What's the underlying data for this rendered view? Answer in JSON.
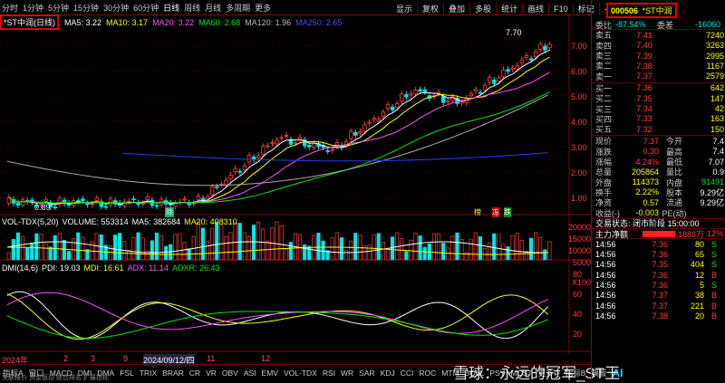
{
  "top_periods": [
    "分时",
    "1分钟",
    "5分钟",
    "15分钟",
    "30分钟",
    "60分钟",
    "日线",
    "周线",
    "月线",
    "多周期",
    "更多"
  ],
  "active_period": "日线",
  "toolbar": [
    "显示",
    "复权",
    "叠加",
    "多股",
    "统计",
    "画线",
    "F10",
    "标记",
    "-自选",
    "返回"
  ],
  "stock_name_badge": "*ST中润(日线)",
  "ma_legend": {
    "ma5": "MA5: 3.22",
    "ma10": "MA10: 3.17",
    "ma20": "MA20: 3.22",
    "ma60": "MA60: 2.68",
    "ma120": "MA120: 1.96",
    "ma250": "MA250: 2.65"
  },
  "price_axis": [
    "7.00",
    "6.00",
    "5.00",
    "4.00",
    "3.00",
    "2.00",
    "1.00"
  ],
  "high_marker": "7.70",
  "low_marker": "0.89",
  "event_labels": {
    "left": "除",
    "right1": "榜",
    "right2": "冻",
    "right3": "跌"
  },
  "vol_legend": {
    "name": "VOL-TDX(5,20)",
    "volume": "VOLUME: 553314",
    "ma5": "MA5: 382684",
    "ma20": "MA20: 408310"
  },
  "vol_axis": [
    "20000",
    "15000",
    "10000",
    "5000",
    "X100"
  ],
  "dmi_legend": {
    "name": "DMI(14,6)",
    "pdi": "PDI: 19.03",
    "mdi": "MDI: 16.61",
    "adx": "ADX: 11.14",
    "adxr": "ADXR: 26.43"
  },
  "dmi_axis": [
    "80",
    "60",
    "40",
    "20"
  ],
  "date_labels": [
    "2024年",
    "2",
    "3",
    "9",
    "2024/09/12/四",
    "11",
    "12"
  ],
  "bottom_tabs": [
    "指标A",
    "窗口",
    "MACD",
    "DMI",
    "DMA",
    "FSL",
    "TRIX",
    "BRAR",
    "CR",
    "VR",
    "OBV",
    "ASI",
    "EMV",
    "VOL-TDX",
    "RSI",
    "WR",
    "SAR",
    "KDJ",
    "CCI",
    "ROC",
    "MTM",
    "BOLL",
    "PSY",
    "MCST",
    "更多 >",
    "指标B",
    "模板",
    "AI"
  ],
  "bottom_sub": "关联报价  资金驱动  综合排名  扩展指标",
  "watermark": "雪球：永远的冠军_ST王",
  "quote": {
    "code": "000506",
    "name": "*ST中润",
    "webi_label": "委比",
    "webi": "-87.54%",
    "weicha_label": "委差",
    "weicha": "-16060",
    "sells": [
      {
        "label": "卖五",
        "price": "7.41",
        "vol": "7240"
      },
      {
        "label": "卖四",
        "price": "7.40",
        "vol": "3263"
      },
      {
        "label": "卖三",
        "price": "7.39",
        "vol": "2995"
      },
      {
        "label": "卖二",
        "price": "7.38",
        "vol": "1167"
      },
      {
        "label": "卖一",
        "price": "7.37",
        "vol": "2579"
      }
    ],
    "buys": [
      {
        "label": "买一",
        "price": "7.36",
        "vol": "642"
      },
      {
        "label": "买二",
        "price": "7.35",
        "vol": "147"
      },
      {
        "label": "买三",
        "price": "7.34",
        "vol": "42"
      },
      {
        "label": "买四",
        "price": "7.33",
        "vol": "163"
      },
      {
        "label": "买五",
        "price": "7.32",
        "vol": "150"
      }
    ],
    "stats": [
      {
        "l1": "现价",
        "v1": "7.37",
        "l2": "今开",
        "v2": "7.4"
      },
      {
        "l1": "涨跌",
        "v1": "0.30",
        "l2": "最高",
        "v2": "7.4"
      },
      {
        "l1": "涨幅",
        "v1": "4.24%",
        "l2": "最低",
        "v2": "7.07"
      },
      {
        "l1": "总量",
        "v1": "205864",
        "l2": "量比",
        "v2": "0.9"
      },
      {
        "l1": "外盘",
        "v1": "114373",
        "l2": "内盘",
        "v2": "91491"
      },
      {
        "l1": "换手",
        "v1": "2.22%",
        "l2": "股本",
        "v2": "9.29亿"
      },
      {
        "l1": "净资",
        "v1": "0.57",
        "l2": "流通",
        "v2": "9.29亿"
      },
      {
        "l1": "收益(-)",
        "v1": "-0.003",
        "l2": "PE(动)",
        "v2": ""
      }
    ],
    "trade_status": "交易状态: 闭市阶段 15:00:00",
    "capital_label": "主力净额",
    "capital_value": "1888万",
    "capital_pct": "12%",
    "ticks": [
      {
        "t": "14:56",
        "p": "7.36",
        "v": "80",
        "s": "S"
      },
      {
        "t": "14:56",
        "p": "7.36",
        "v": "65",
        "s": "S"
      },
      {
        "t": "14:56",
        "p": "7.35",
        "v": "404",
        "s": "S"
      },
      {
        "t": "14:56",
        "p": "7.36",
        "v": "12",
        "s": "B"
      },
      {
        "t": "14:56",
        "p": "7.36",
        "v": "5",
        "s": "S"
      },
      {
        "t": "14:56",
        "p": "7.37",
        "v": "38",
        "s": "B"
      },
      {
        "t": "14:56",
        "p": "7.37",
        "v": "221",
        "s": "B"
      },
      {
        "t": "14:56",
        "p": "7.38",
        "v": "20",
        "s": "B"
      }
    ]
  }
}
